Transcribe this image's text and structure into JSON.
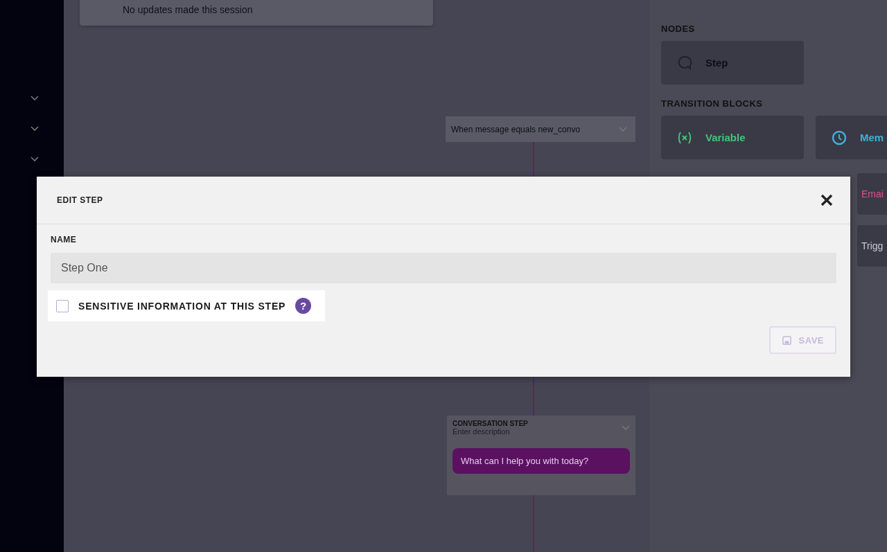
{
  "session_card": {
    "text": "No updates made this session"
  },
  "canvas": {
    "trigger": {
      "text": "When message equals new_convo"
    },
    "conversation_step": {
      "title": "CONVERSATION STEP",
      "description": "Enter description",
      "message": "What can I help you with today?"
    }
  },
  "palette": {
    "nodes_title": "NODES",
    "nodes": [
      {
        "label": "Step"
      }
    ],
    "transition_title": "TRANSITION BLOCKS",
    "blocks": [
      {
        "label": "Variable",
        "color": "#43c47a",
        "kind": "variable"
      },
      {
        "label": "Mem",
        "color": "#3fb0dc",
        "kind": "clock"
      }
    ],
    "more_blocks": [
      {
        "label": "Emai",
        "color": "#e0508a"
      },
      {
        "label": "Trigg",
        "color": "#c8c8d4"
      }
    ]
  },
  "modal": {
    "title": "EDIT STEP",
    "name_label": "NAME",
    "name_value": "Step One",
    "sensitive": {
      "label": "SENSITIVE INFORMATION AT THIS STEP",
      "checked": false,
      "help": "?"
    },
    "save_button": "SAVE"
  }
}
